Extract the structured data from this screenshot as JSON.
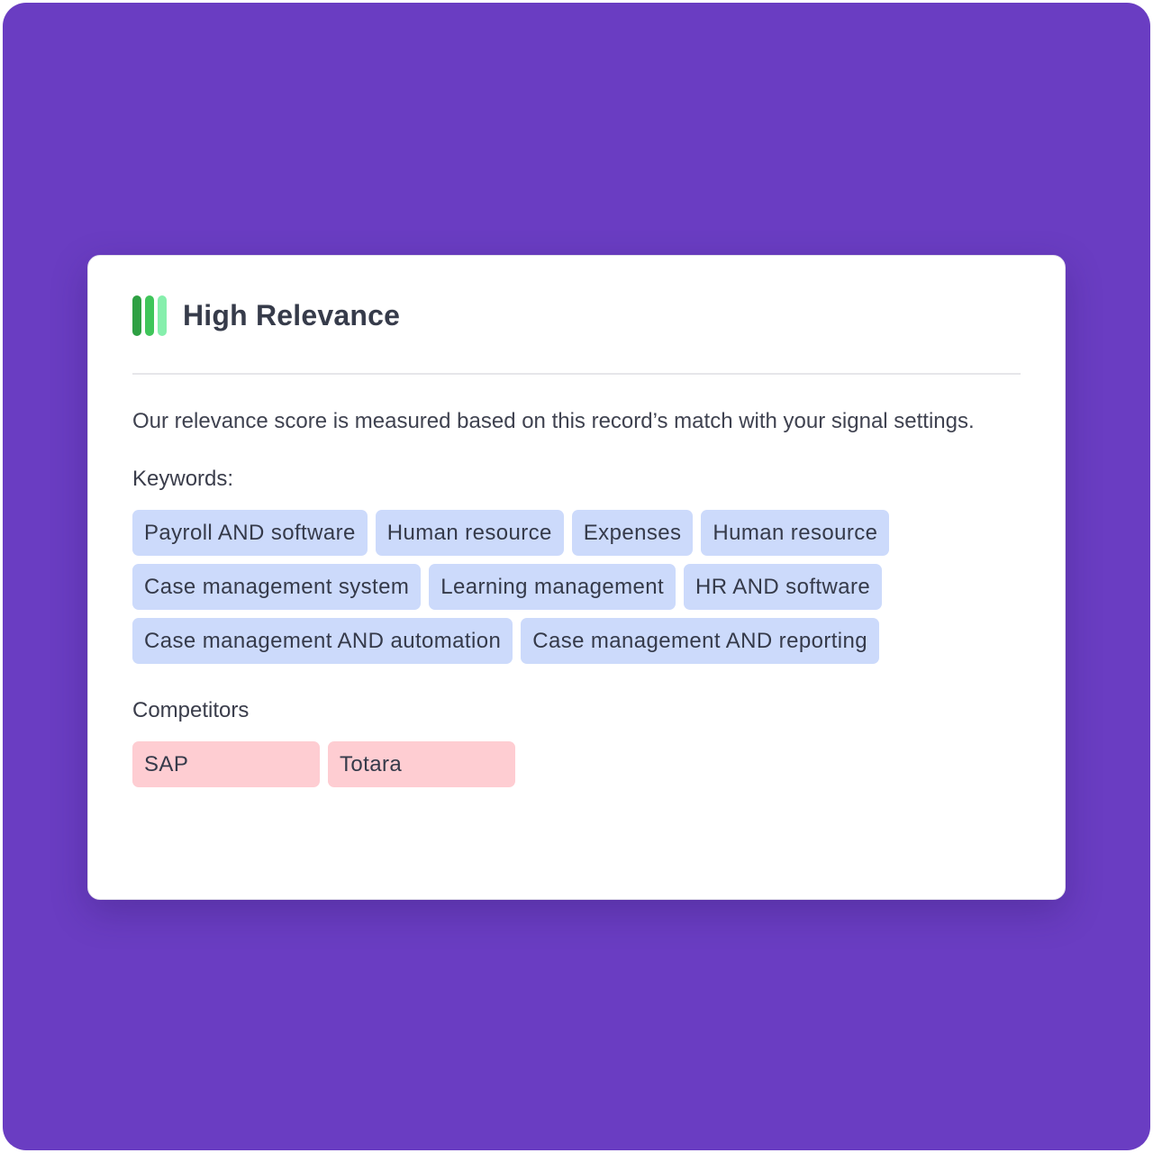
{
  "card": {
    "title": "High Relevance",
    "relevance_icon": "relevance-bars-icon",
    "relevance_colors": [
      "#2ea043",
      "#3fc55a",
      "#86efac"
    ],
    "description": "Our relevance score is measured based on this record’s match with your signal settings.",
    "keywords_label": "Keywords:",
    "keywords": [
      "Payroll AND software",
      "Human resource",
      "Expenses",
      "Human resource",
      "Case management system",
      "Learning management",
      "HR AND software",
      "Case management AND automation",
      "Case management AND reporting"
    ],
    "competitors_label": "Competitors",
    "competitors": [
      "SAP",
      "Totara"
    ]
  },
  "colors": {
    "background": "#6a3dc2",
    "keyword_chip": "#ccdafb",
    "competitor_chip": "#fecdd2"
  }
}
